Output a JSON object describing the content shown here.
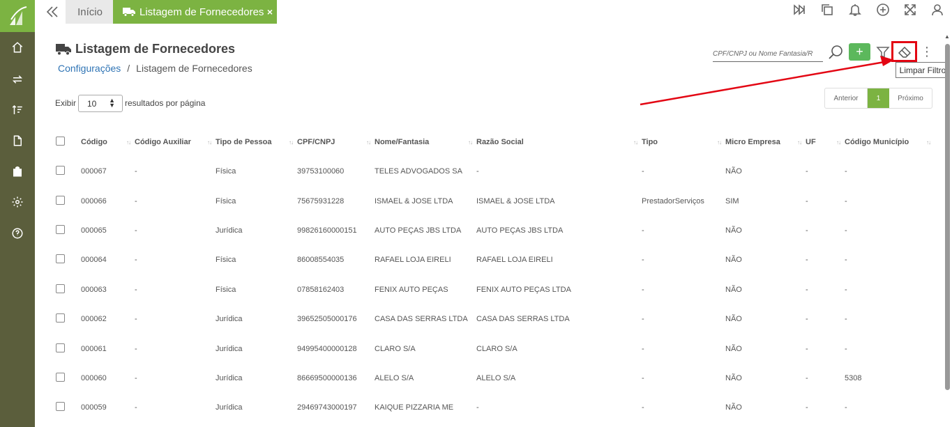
{
  "tabs": {
    "home_label": "Início",
    "active_label": "Listagem de Fornecedores",
    "close_glyph": "×"
  },
  "header": {
    "title": "Listagem de Fornecedores",
    "breadcrumb_root": "Configurações",
    "breadcrumb_sep": "/",
    "breadcrumb_current": "Listagem de Fornecedores"
  },
  "toolbar": {
    "search_placeholder": "CPF/CNPJ ou Nome Fantasia/R",
    "add_label": "+",
    "more_glyph": "⋮",
    "tooltip": "Limpar Filtro"
  },
  "pagination": {
    "show_label": "Exibir",
    "page_size": "10",
    "per_page_label": "resultados por página",
    "prev": "Anterior",
    "current": "1",
    "next": "Próximo"
  },
  "table": {
    "columns": [
      "Código",
      "Código Auxiliar",
      "Tipo de Pessoa",
      "CPF/CNPJ",
      "Nome/Fantasia",
      "Razão Social",
      "Tipo",
      "Micro Empresa",
      "UF",
      "Código Município"
    ],
    "rows": [
      [
        "000067",
        "-",
        "Física",
        "39753100060",
        "TELES ADVOGADOS SA",
        "-",
        "-",
        "NÃO",
        "-",
        "-"
      ],
      [
        "000066",
        "-",
        "Física",
        "75675931228",
        "ISMAEL & JOSE LTDA",
        "ISMAEL & JOSE LTDA",
        "PrestadorServiços",
        "SIM",
        "-",
        "-"
      ],
      [
        "000065",
        "-",
        "Jurídica",
        "99826160000151",
        "AUTO PEÇAS JBS LTDA",
        "AUTO PEÇAS JBS LTDA",
        "-",
        "NÃO",
        "-",
        "-"
      ],
      [
        "000064",
        "-",
        "Física",
        "86008554035",
        "RAFAEL LOJA EIRELI",
        "RAFAEL LOJA EIRELI",
        "-",
        "NÃO",
        "-",
        "-"
      ],
      [
        "000063",
        "-",
        "Física",
        "07858162403",
        "FENIX AUTO PEÇAS",
        "FENIX AUTO PEÇAS LTDA",
        "-",
        "NÃO",
        "-",
        "-"
      ],
      [
        "000062",
        "-",
        "Jurídica",
        "39652505000176",
        "CASA DAS SERRAS LTDA",
        "CASA DAS SERRAS LTDA",
        "-",
        "NÃO",
        "-",
        "-"
      ],
      [
        "000061",
        "-",
        "Jurídica",
        "94995400000128",
        "CLARO S/A",
        "CLARO S/A",
        "-",
        "NÃO",
        "-",
        "-"
      ],
      [
        "000060",
        "-",
        "Jurídica",
        "86669500000136",
        "ALELO S/A",
        "ALELO S/A",
        "-",
        "NÃO",
        "-",
        "5308"
      ],
      [
        "000059",
        "-",
        "Jurídica",
        "29469743000197",
        "KAIQUE PIZZARIA ME",
        "-",
        "-",
        "NÃO",
        "-",
        "-"
      ]
    ]
  },
  "colors": {
    "accent": "#7cb342",
    "sidebar": "#5b5e3c",
    "highlight": "#e30613",
    "link": "#2f74b5"
  },
  "icons": {
    "sidebar": [
      "home-icon",
      "exchange-icon",
      "sort-icon",
      "document-icon",
      "bag-icon",
      "gear-icon",
      "help-icon"
    ],
    "topbar": [
      "skip-forward-icon",
      "copy-icon",
      "bell-icon",
      "plus-circle-icon",
      "expand-icon",
      "user-icon"
    ]
  }
}
